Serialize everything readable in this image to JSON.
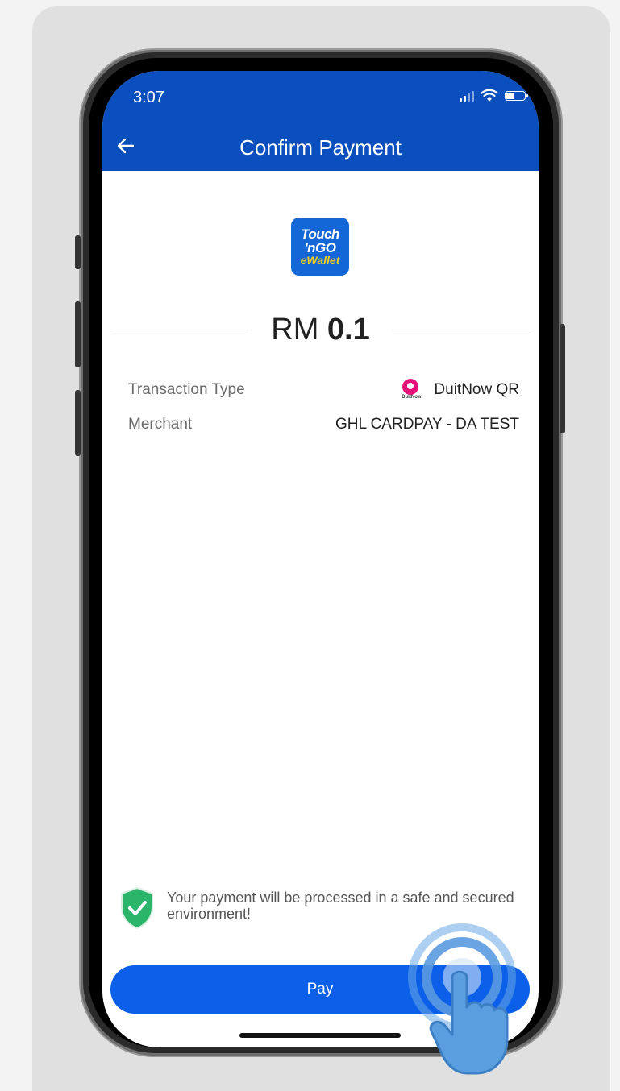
{
  "status_bar": {
    "time": "3:07",
    "signal_icon": "signal-bars-icon",
    "wifi_icon": "wifi-icon",
    "battery_icon": "battery-icon"
  },
  "header": {
    "title": "Confirm Payment",
    "back_icon": "arrow-left-icon",
    "background": "#0a4fbd"
  },
  "logo": {
    "line1": "Touch",
    "line2": "'nGO",
    "line3": "eWallet"
  },
  "amount": {
    "currency": "RM",
    "value": "0.1"
  },
  "details": {
    "transaction_type_label": "Transaction Type",
    "transaction_type_value": "DuitNow QR",
    "transaction_type_icon": "duitnow-icon",
    "duitnow_icon_text": "DuitNow",
    "merchant_label": "Merchant",
    "merchant_value": "GHL CARDPAY - DA TEST"
  },
  "security_note": {
    "icon": "shield-check-icon",
    "text": "Your payment will be processed in a safe and secured environment!"
  },
  "pay_button": {
    "label": "Pay",
    "color": "#0b5fe8"
  },
  "overlay": {
    "icon": "tap-hand-icon"
  }
}
